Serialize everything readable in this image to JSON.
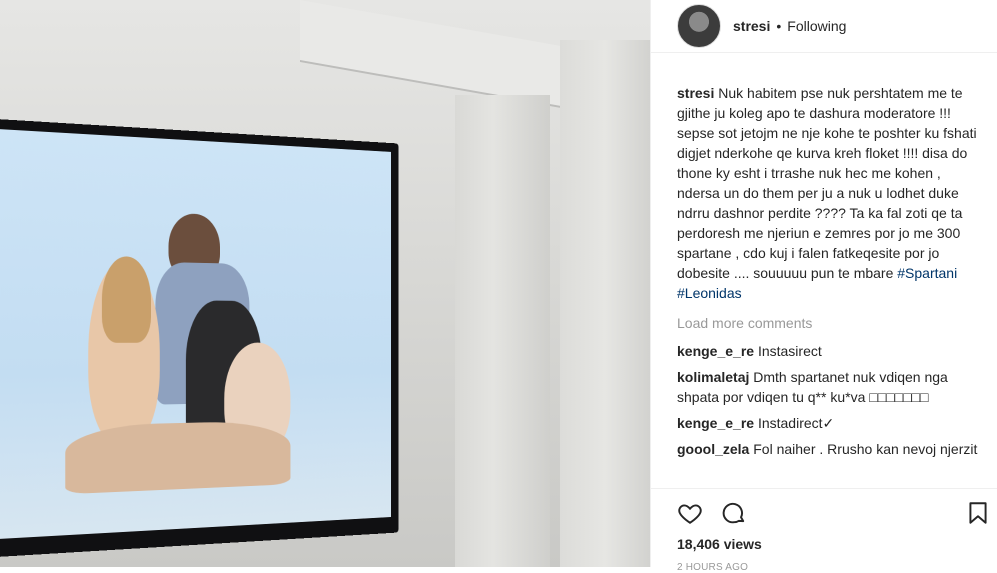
{
  "post": {
    "username": "stresi",
    "separator": "•",
    "follow_status": "Following"
  },
  "caption": {
    "username": "stresi",
    "text": "Nuk habitem pse nuk pershtatem me te gjithe ju koleg apo te dashura moderatore !!! sepse sot jetojm ne nje kohe te poshter ku fshati digjet nderkohe qe kurva kreh floket !!!! disa do thone ky esht i trrashe nuk hec me kohen , ndersa un do them per ju a nuk u lodhet duke ndrru dashnor perdite ???? Ta ka fal zoti qe ta perdoresh me njeriun e zemres por jo me 300 spartane , cdo kuj i falen fatkeqesite por jo dobesite .... souuuuu pun te mbare",
    "hashtag1": "#Spartani",
    "hashtag2": "#Leonidas"
  },
  "load_more": "Load more comments",
  "comments": [
    {
      "user": "kenge_e_re",
      "text": "Instasirect"
    },
    {
      "user": "kolimaletaj",
      "text": "Dmth spartanet nuk vdiqen nga shpata por vdiqen tu q** ku*va □□□□□□□"
    },
    {
      "user": "kenge_e_re",
      "text": "Instadirect✓"
    },
    {
      "user": "goool_zela",
      "text": "Fol naiher . Rrusho kan nevoj njerzit"
    }
  ],
  "icons": {
    "like": "heart-icon",
    "comment": "comment-bubble-icon",
    "save": "bookmark-icon"
  },
  "views": "18,406 views",
  "timestamp": "2 HOURS AGO"
}
